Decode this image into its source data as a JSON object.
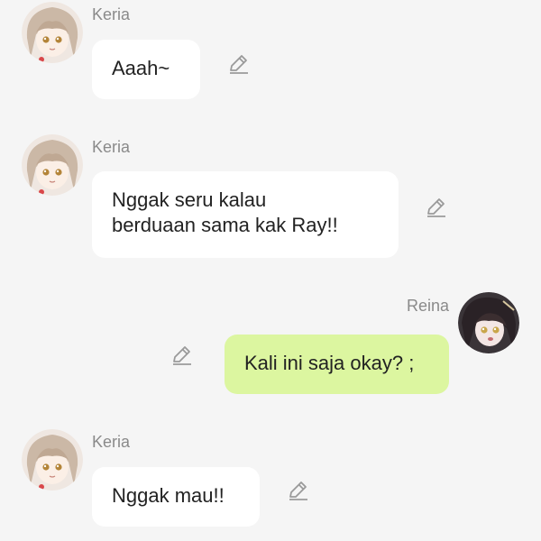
{
  "colors": {
    "background": "#f5f5f5",
    "bubble_other": "#ffffff",
    "bubble_self": "#dcf6a0",
    "name_text": "#8a8a8a",
    "message_text": "#222222",
    "edit_icon": "#9a9a9a"
  },
  "messages": [
    {
      "sender": "Keria",
      "side": "left",
      "text": "Aaah~",
      "avatar_icon": "keria-avatar",
      "action_icon": "pencil-edit-icon"
    },
    {
      "sender": "Keria",
      "side": "left",
      "text": "Nggak seru kalau\nberduaan sama kak Ray!!",
      "avatar_icon": "keria-avatar",
      "action_icon": "pencil-edit-icon"
    },
    {
      "sender": "Reina",
      "side": "right",
      "text": "Kali ini saja okay? ;",
      "avatar_icon": "reina-avatar",
      "action_icon": "pencil-edit-icon"
    },
    {
      "sender": "Keria",
      "side": "left",
      "text": "Nggak mau!!",
      "avatar_icon": "keria-avatar",
      "action_icon": "pencil-edit-icon"
    }
  ]
}
